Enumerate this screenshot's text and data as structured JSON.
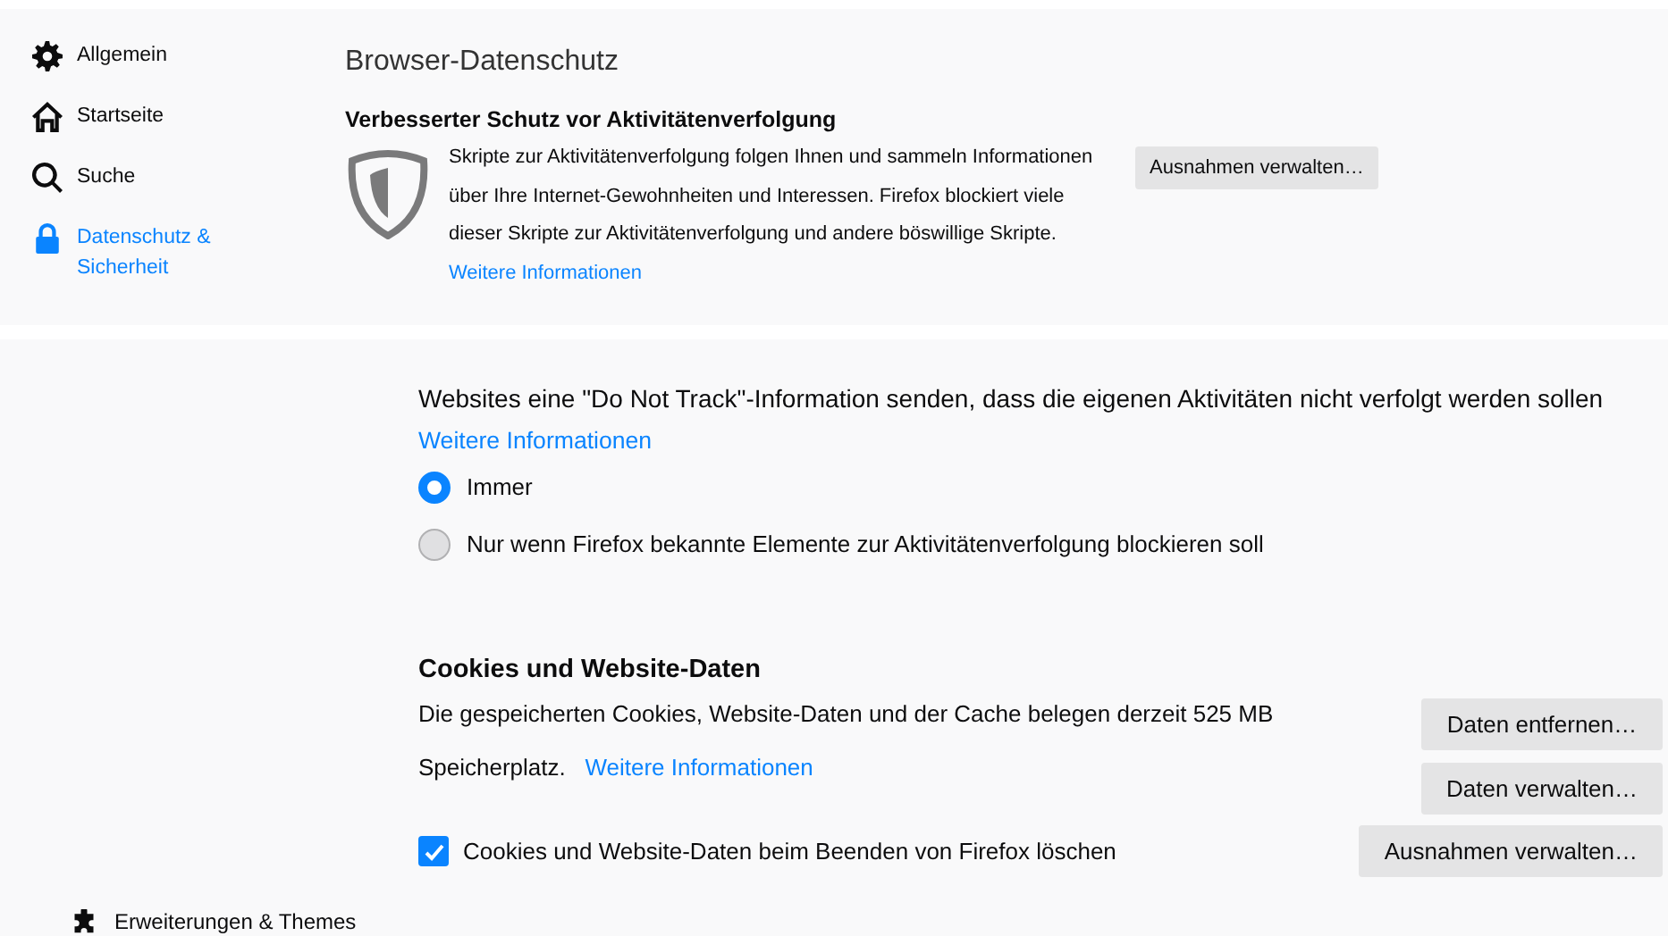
{
  "sidebar": {
    "items": [
      {
        "label": "Allgemein",
        "selected": false
      },
      {
        "label": "Startseite",
        "selected": false
      },
      {
        "label": "Suche",
        "selected": false
      },
      {
        "label": "Datenschutz & Sicherheit",
        "selected": true
      }
    ],
    "footer_item": {
      "label": "Erweiterungen & Themes"
    }
  },
  "header": {
    "title": "Browser-Datenschutz"
  },
  "tracking_protection": {
    "title": "Verbesserter Schutz vor Aktivitätenverfolgung",
    "description": "Skripte zur Aktivitätenverfolgung folgen Ihnen und sammeln Informationen über Ihre Internet-Gewohnheiten und Interessen. Firefox blockiert viele dieser Skripte zur Aktivitätenverfolgung und andere böswillige Skripte.",
    "link": "Weitere Informationen",
    "button": "Ausnahmen verwalten…"
  },
  "do_not_track": {
    "description": "Websites eine \"Do Not Track\"-Information senden, dass die eigenen Aktivitäten nicht verfolgt werden sollen",
    "link": "Weitere Informationen",
    "options": [
      {
        "label": "Immer",
        "selected": true
      },
      {
        "label": "Nur wenn Firefox bekannte Elemente zur Aktivitätenverfolgung blockieren soll",
        "selected": false
      }
    ]
  },
  "cookies": {
    "title": "Cookies und Website-Daten",
    "description": "Die gespeicherten Cookies, Website-Daten und der Cache belegen derzeit 525 MB Speicherplatz.",
    "link": "Weitere Informationen",
    "buttons": [
      "Daten entfernen…",
      "Daten verwalten…"
    ],
    "checkbox": {
      "label": "Cookies und Website-Daten beim Beenden von Firefox löschen",
      "checked": true
    },
    "checkbox_button": "Ausnahmen verwalten…"
  }
}
